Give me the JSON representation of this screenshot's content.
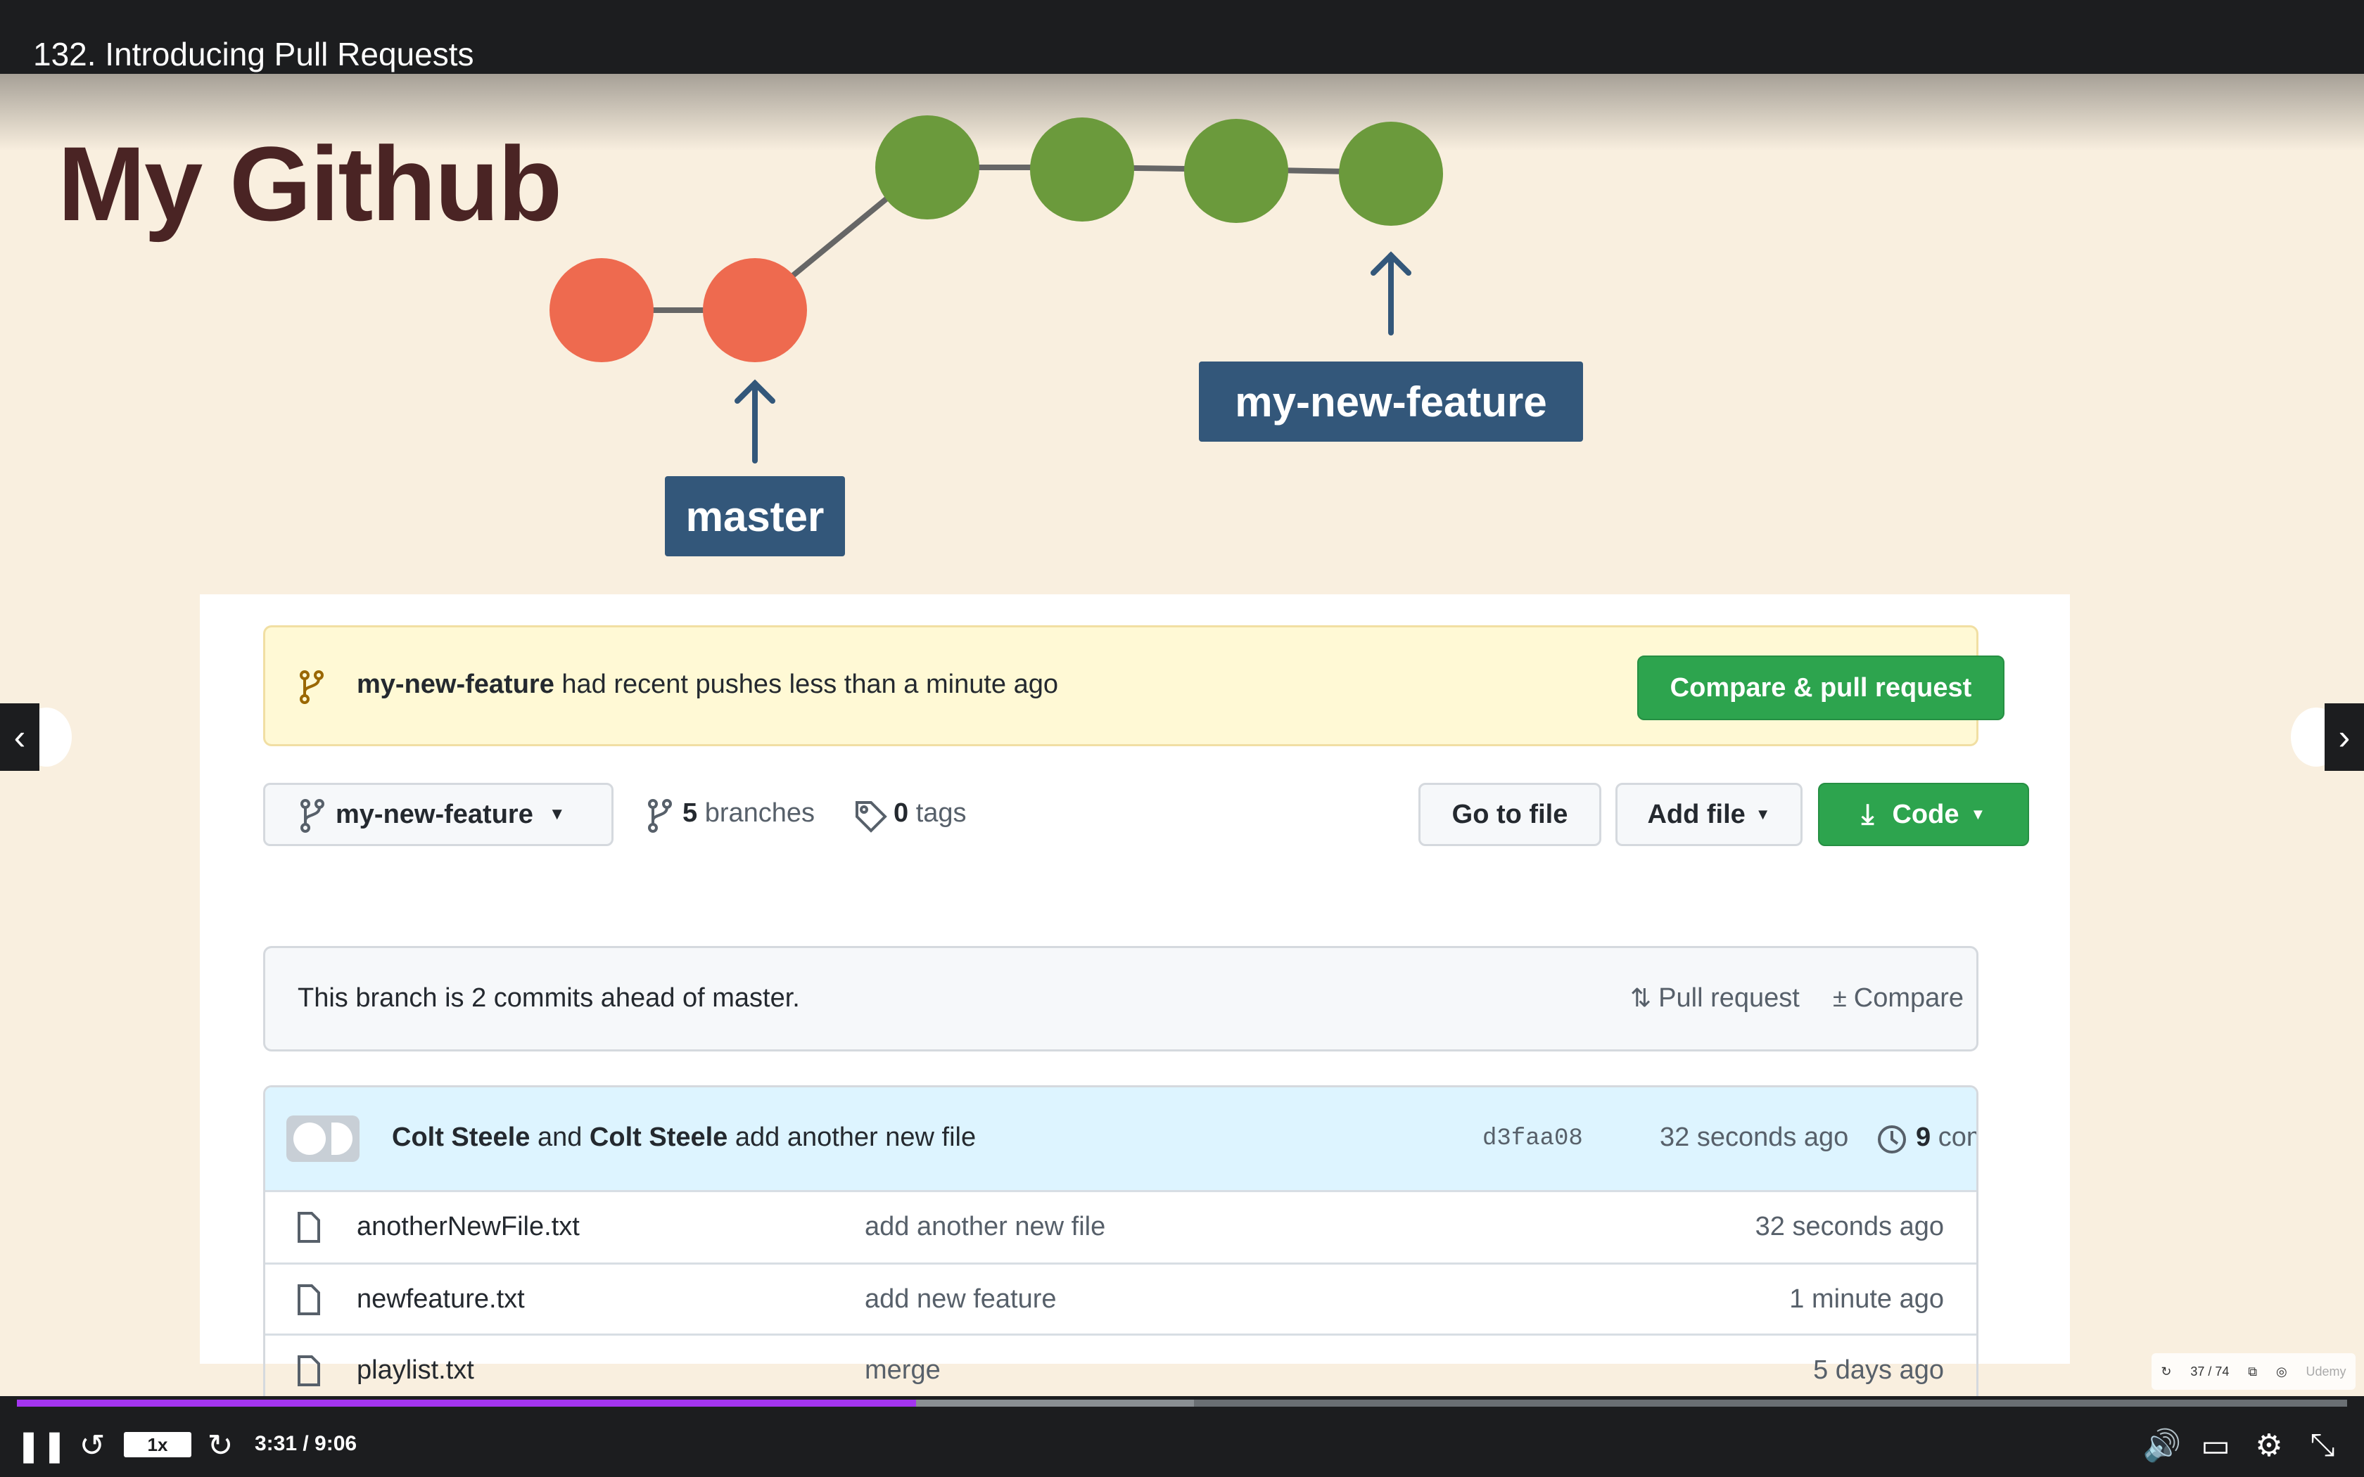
{
  "lecture": {
    "title": "132. Introducing Pull Requests"
  },
  "slide": {
    "title": "My Github",
    "labels": {
      "master": "master",
      "feature": "my-new-feature"
    }
  },
  "github": {
    "banner": {
      "branch": "my-new-feature",
      "text": " had recent pushes less than a minute ago",
      "button": "Compare & pull request"
    },
    "branch_select": "my-new-feature",
    "branches": {
      "count": "5",
      "label": " branches"
    },
    "tags": {
      "count": "0",
      "label": " tags"
    },
    "buttons": {
      "go_to_file": "Go to file",
      "add_file": "Add file",
      "code": "Code"
    },
    "ahead": {
      "text": "This branch is 2 commits ahead of master.",
      "pull_request": "Pull request",
      "compare": "Compare"
    },
    "commit": {
      "author1": "Colt Steele",
      "and": " and ",
      "author2": "Colt Steele",
      "message": " add another new file",
      "sha": "d3faa08",
      "time": "32 seconds ago",
      "count": "9",
      "count_label": " commits"
    },
    "files": [
      {
        "name": "anotherNewFile.txt",
        "message": "add another new file",
        "time": "32 seconds ago"
      },
      {
        "name": "newfeature.txt",
        "message": "add new feature",
        "time": "1 minute ago"
      },
      {
        "name": "playlist.txt",
        "message": "merge",
        "time": "5 days ago"
      }
    ]
  },
  "player": {
    "speed": "1x",
    "time": "3:31 / 9:06",
    "progress_fraction": 0.386,
    "buffered_fraction": 0.505,
    "mini_counter": "37 / 74",
    "watermark": "Udemy"
  },
  "colors": {
    "accent_purple": "#a435f0",
    "github_green": "#2da44e",
    "label_blue": "#33577a",
    "master_red": "#ee6a4f",
    "feature_green": "#6b9a3c"
  }
}
